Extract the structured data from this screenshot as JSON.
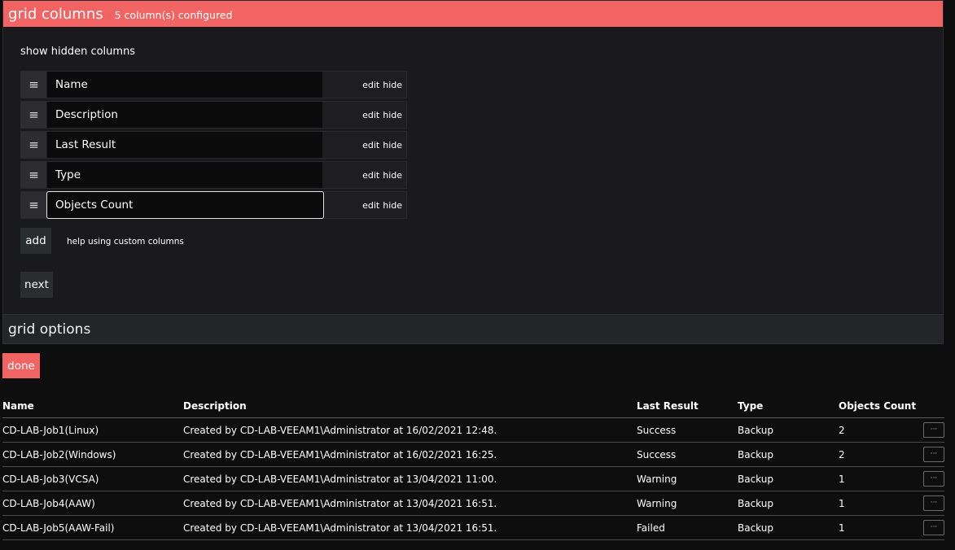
{
  "panel": {
    "title": "grid columns",
    "subtitle": "5 column(s) configured",
    "show_hidden_label": "show hidden columns",
    "columns": [
      {
        "name": "Name",
        "edit": "edit",
        "hide": "hide"
      },
      {
        "name": "Description",
        "edit": "edit",
        "hide": "hide"
      },
      {
        "name": "Last Result",
        "edit": "edit",
        "hide": "hide"
      },
      {
        "name": "Type",
        "edit": "edit",
        "hide": "hide"
      },
      {
        "name": "Objects Count",
        "edit": "edit",
        "hide": "hide",
        "focused": true
      }
    ],
    "drag_glyph": "≡",
    "add_label": "add",
    "help_label": "help using custom columns",
    "next_label": "next"
  },
  "options": {
    "title": "grid options"
  },
  "done_label": "done",
  "table": {
    "headers": {
      "name": "Name",
      "description": "Description",
      "last_result": "Last Result",
      "type": "Type",
      "objects_count": "Objects Count"
    },
    "rows": [
      {
        "name": "CD-LAB-Job1(Linux)",
        "description": "Created by CD-LAB-VEEAM1\\Administrator at 16/02/2021 12:48.",
        "last_result": "Success",
        "type": "Backup",
        "objects_count": "2"
      },
      {
        "name": "CD-LAB-Job2(Windows)",
        "description": "Created by CD-LAB-VEEAM1\\Administrator at 16/02/2021 16:25.",
        "last_result": "Success",
        "type": "Backup",
        "objects_count": "2"
      },
      {
        "name": "CD-LAB-Job3(VCSA)",
        "description": "Created by CD-LAB-VEEAM1\\Administrator at 13/04/2021 11:00.",
        "last_result": "Warning",
        "type": "Backup",
        "objects_count": "1"
      },
      {
        "name": "CD-LAB-Job4(AAW)",
        "description": "Created by CD-LAB-VEEAM1\\Administrator at 13/04/2021 16:51.",
        "last_result": "Warning",
        "type": "Backup",
        "objects_count": "1"
      },
      {
        "name": "CD-LAB-Job5(AAW-Fail)",
        "description": "Created by CD-LAB-VEEAM1\\Administrator at 13/04/2021 16:51.",
        "last_result": "Failed",
        "type": "Backup",
        "objects_count": "1"
      }
    ],
    "row_menu_glyph": "···"
  },
  "colors": {
    "accent": "#f26363",
    "panel_bg": "#1a1a1c",
    "page_bg": "#0e0e0f"
  }
}
